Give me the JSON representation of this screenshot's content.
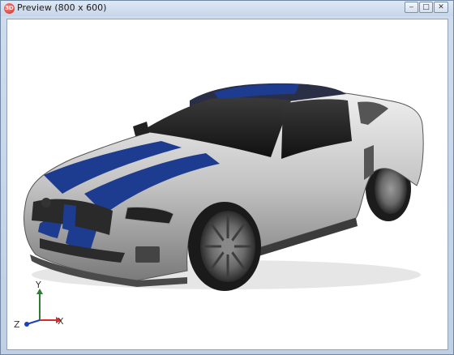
{
  "window": {
    "title": "Preview (800 x 600)",
    "icon": "app-logo-icon",
    "controls": {
      "minimize": "‒",
      "maximize": "□",
      "close": "✕"
    }
  },
  "viewport": {
    "background": "#ffffff",
    "car": {
      "body_color": "#c8c8c8",
      "stripe_color": "#1d3b8f"
    },
    "axes": {
      "y": "Y",
      "x": "X",
      "z": "Z"
    },
    "axis_colors": {
      "y": "#2e7d32",
      "x": "#d32f2f",
      "z": "#1e40c0"
    }
  }
}
